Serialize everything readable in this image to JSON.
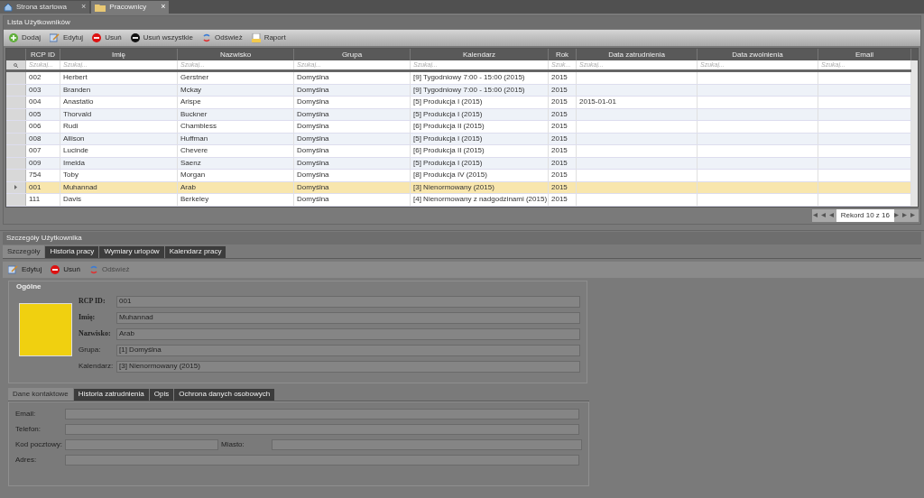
{
  "doc_tabs": [
    {
      "label": "Strona startowa",
      "selected": false,
      "close": "×"
    },
    {
      "label": "Pracownicy",
      "selected": true,
      "close": "×"
    }
  ],
  "list_panel": {
    "title": "Lista Użytkowników",
    "toolbar": [
      {
        "label": "Dodaj"
      },
      {
        "label": "Edytuj"
      },
      {
        "label": "Usuń"
      },
      {
        "label": "Usuń wszystkie"
      },
      {
        "label": "Odśwież"
      },
      {
        "label": "Raport"
      }
    ],
    "table": {
      "columns": [
        {
          "label": "RCP ID",
          "placeholder": "Szukaj..."
        },
        {
          "label": "Imię",
          "placeholder": "Szukaj..."
        },
        {
          "label": "Nazwisko",
          "placeholder": "Szukaj..."
        },
        {
          "label": "Grupa",
          "placeholder": "Szukaj..."
        },
        {
          "label": "Kalendarz",
          "placeholder": "Szukaj..."
        },
        {
          "label": "Rok",
          "placeholder": "Szuk..."
        },
        {
          "label": "Data zatrudnienia",
          "placeholder": "Szukaj..."
        },
        {
          "label": "Data zwolnienia",
          "placeholder": "Szukaj..."
        },
        {
          "label": "Email",
          "placeholder": "Szukaj..."
        }
      ],
      "rows": [
        {
          "selected": false,
          "cells": [
            "002",
            "Herbert",
            "Gerstner",
            "Domyślna",
            "[9] Tygodniowy 7:00 - 15:00 (2015)",
            "2015",
            "",
            "",
            ""
          ]
        },
        {
          "selected": false,
          "cells": [
            "003",
            "Branden",
            "Mckay",
            "Domyślna",
            "[9] Tygodniowy 7:00 - 15:00 (2015)",
            "2015",
            "",
            "",
            ""
          ]
        },
        {
          "selected": false,
          "cells": [
            "004",
            "Anastatio",
            "Arispe",
            "Domyślna",
            "[5] Produkcja I (2015)",
            "2015",
            "2015-01-01",
            "",
            ""
          ]
        },
        {
          "selected": false,
          "cells": [
            "005",
            "Thorvald",
            "Buckner",
            "Domyślna",
            "[5] Produkcja I (2015)",
            "2015",
            "",
            "",
            ""
          ]
        },
        {
          "selected": false,
          "cells": [
            "006",
            "Rudi",
            "Chambless",
            "Domyślna",
            "[6] Produkcja II (2015)",
            "2015",
            "",
            "",
            ""
          ]
        },
        {
          "selected": false,
          "cells": [
            "008",
            "Allison",
            "Huffman",
            "Domyślna",
            "[5] Produkcja I (2015)",
            "2015",
            "",
            "",
            ""
          ]
        },
        {
          "selected": false,
          "cells": [
            "007",
            "Lucinde",
            "Chevere",
            "Domyślna",
            "[6] Produkcja II (2015)",
            "2015",
            "",
            "",
            ""
          ]
        },
        {
          "selected": false,
          "cells": [
            "009",
            "Imelda",
            "Saenz",
            "Domyślna",
            "[5] Produkcja I (2015)",
            "2015",
            "",
            "",
            ""
          ]
        },
        {
          "selected": false,
          "cells": [
            "754",
            "Toby",
            "Morgan",
            "Domyślna",
            "[8] Produkcja IV (2015)",
            "2015",
            "",
            "",
            ""
          ]
        },
        {
          "selected": true,
          "cells": [
            "001",
            "Muhannad",
            "Arab",
            "Domyślna",
            "[3] Nienormowany (2015)",
            "2015",
            "",
            "",
            ""
          ]
        },
        {
          "selected": false,
          "cells": [
            "111",
            "Davis",
            "Berkeley",
            "Domyślna",
            "[4] Nienormowany z nadgodzinami (2015)",
            "2015",
            "",
            "",
            ""
          ]
        }
      ]
    },
    "pager": {
      "record": "Rekord 10 z 16"
    }
  },
  "detail_panel": {
    "title": "Szczegóły Użytkownika",
    "tabs": [
      {
        "label": "Szczegóły",
        "selected": true
      },
      {
        "label": "Historia pracy",
        "selected": false
      },
      {
        "label": "Wymiary urlopów",
        "selected": false
      },
      {
        "label": "Kalendarz pracy",
        "selected": false
      }
    ],
    "toolbar": [
      {
        "label": "Edytuj",
        "disabled": false
      },
      {
        "label": "Usuń",
        "disabled": false
      },
      {
        "label": "Odśwież",
        "disabled": true
      }
    ],
    "general": {
      "title": "Ogólne",
      "fields": [
        {
          "label": "RCP ID:",
          "value": "001",
          "bold": true
        },
        {
          "label": "Imię:",
          "value": "Muhannad",
          "bold": true
        },
        {
          "label": "Nazwisko:",
          "value": "Arab",
          "bold": true
        },
        {
          "label": "Grupa:",
          "value": "[1] Domyślna",
          "bold": false
        },
        {
          "label": "Kalendarz:",
          "value": "[3] Nienormowany (2015)",
          "bold": false
        }
      ]
    },
    "contact_tabs": [
      {
        "label": "Dane kontaktowe",
        "selected": true
      },
      {
        "label": "Historia zatrudnienia",
        "selected": false
      },
      {
        "label": "Opis",
        "selected": false
      },
      {
        "label": "Ochrona danych osobowych",
        "selected": false
      }
    ],
    "contact": {
      "email": "Email:",
      "phone": "Telefon:",
      "postcode": "Kod pocztowy:",
      "city": "Miasto:",
      "address": "Adres:"
    }
  }
}
